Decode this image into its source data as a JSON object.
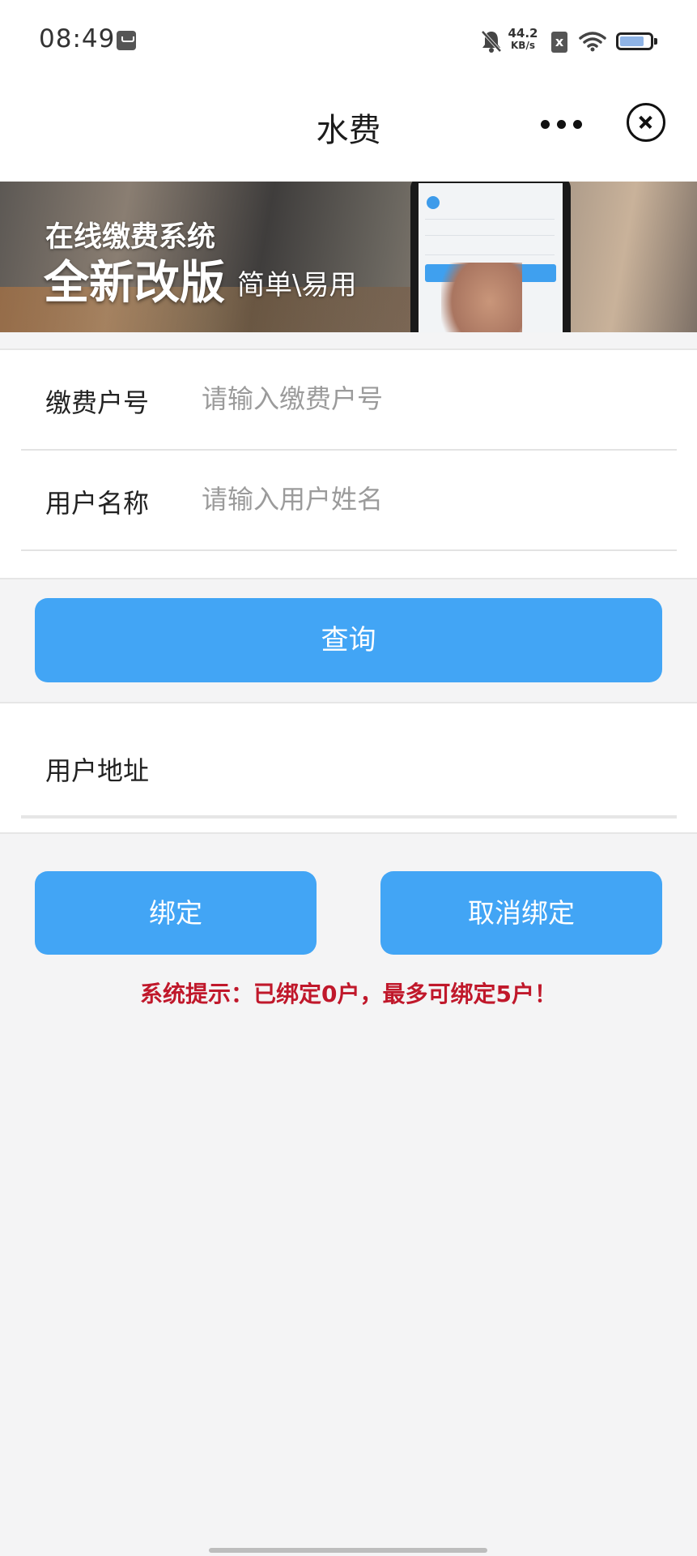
{
  "status_bar": {
    "time": "08:49",
    "net_speed_value": "44.2",
    "net_speed_unit": "KB/s",
    "sim_label": "x",
    "icons": [
      "app-notification-icon",
      "bell-muted-icon",
      "sim-icon",
      "wifi-icon",
      "battery-icon"
    ]
  },
  "nav": {
    "title": "水费",
    "more_icon": "more-dots-icon",
    "close_icon": "close-circle-icon"
  },
  "banner": {
    "line1": "在线缴费系统",
    "line2": "全新改版",
    "line3": "简单\\易用"
  },
  "form": {
    "account_label": "缴费户号",
    "account_placeholder": "请输入缴费户号",
    "account_value": "",
    "name_label": "用户名称",
    "name_placeholder": "请输入用户姓名",
    "name_value": ""
  },
  "query_button": "查询",
  "address": {
    "label": "用户地址",
    "value": ""
  },
  "actions": {
    "bind": "绑定",
    "unbind": "取消绑定"
  },
  "system_tip": "系统提示：已绑定0户，最多可绑定5户！",
  "colors": {
    "primary": "#42a5f5",
    "tip": "#c0182b",
    "background": "#f4f4f5"
  }
}
